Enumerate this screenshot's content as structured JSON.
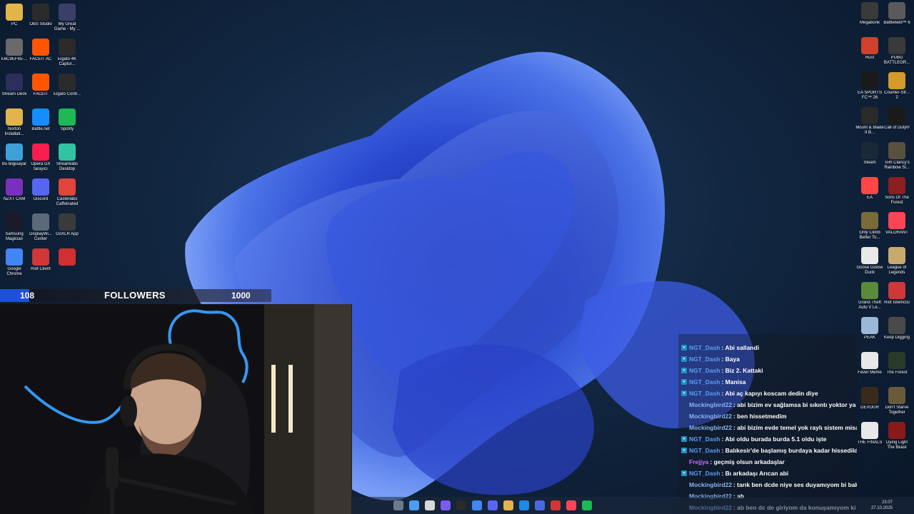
{
  "desktop_icons_left": [
    {
      "label": "PC",
      "icon": "folder-icon",
      "color": "#e2b54a"
    },
    {
      "label": "OBS Studio",
      "icon": "obs-icon",
      "color": "#2b2b2b"
    },
    {
      "label": "My Great Game - My ...",
      "icon": "game-icon",
      "color": "#3a3f6a"
    },
    {
      "label": "E6C9EF65-...",
      "icon": "file-icon",
      "color": "#6a6a6a"
    },
    {
      "label": "FACEIT AC",
      "icon": "faceit-icon",
      "color": "#ff5500"
    },
    {
      "label": "Elgato 4K Captur...",
      "icon": "elgato-4k-icon",
      "color": "#2b2b2b"
    },
    {
      "label": "Stream Deck",
      "icon": "stream-deck-icon",
      "color": "#2b2f5a"
    },
    {
      "label": "FACEIT",
      "icon": "faceit-icon",
      "color": "#ff5500"
    },
    {
      "label": "Elgato Contr...",
      "icon": "elgato-control-icon",
      "color": "#2b2b2b"
    },
    {
      "label": "Norton Installati...",
      "icon": "folder-icon",
      "color": "#e2b54a"
    },
    {
      "label": "Battle.net",
      "icon": "battlenet-icon",
      "color": "#148eff"
    },
    {
      "label": "Spotify",
      "icon": "spotify-icon",
      "color": "#1db954"
    },
    {
      "label": "Bu bilgisayar",
      "icon": "monitor-icon",
      "color": "#3ea0d8"
    },
    {
      "label": "Opera GX tarayıcı",
      "icon": "opera-gx-icon",
      "color": "#fa1e4e"
    },
    {
      "label": "Streamlabs Desktop",
      "icon": "streamlabs-icon",
      "color": "#31c3a2"
    },
    {
      "label": "NZXT CAM",
      "icon": "nzxt-icon",
      "color": "#7b2fbe"
    },
    {
      "label": "Discord",
      "icon": "discord-icon",
      "color": "#5865f2"
    },
    {
      "label": "Casterlabs Caffeinated",
      "icon": "casterlabs-icon",
      "color": "#e0443a"
    },
    {
      "label": "Samsung Magician",
      "icon": "samsung-magician-icon",
      "color": "#1a1a2a"
    },
    {
      "label": "DisplayWi... Center",
      "icon": "display-center-icon",
      "color": "#5a6a7a"
    },
    {
      "label": "GoXLR App",
      "icon": "goxlr-icon",
      "color": "#3a3a3a"
    },
    {
      "label": "Google Chrome",
      "icon": "chrome-icon",
      "color": "#4285f4"
    },
    {
      "label": "Riot Client",
      "icon": "riot-client-icon",
      "color": "#d13639"
    },
    {
      "label": "",
      "icon": "app-icon",
      "color": "#d03030"
    }
  ],
  "desktop_icons_right": [
    {
      "label": "Megabonk",
      "icon": "megabonk-icon",
      "color": "#3a3a3a"
    },
    {
      "label": "Battlefield™ 6",
      "icon": "battlefield-icon",
      "color": "#5a5a5a"
    },
    {
      "label": "Rust",
      "icon": "rust-icon",
      "color": "#ce412b"
    },
    {
      "label": "PUBG BATTLEGR...",
      "icon": "pubg-icon",
      "color": "#3a3a3a"
    },
    {
      "label": "EA SPORTS FC™ 26",
      "icon": "ea-fc-icon",
      "color": "#1a1a1a"
    },
    {
      "label": "Counter-Str... 2",
      "icon": "counter-strike-icon",
      "color": "#d49a2a"
    },
    {
      "label": "Mount & Blade II B...",
      "icon": "mount-blade-icon",
      "color": "#2a2a2a"
    },
    {
      "label": "Call of Duty®",
      "icon": "call-of-duty-icon",
      "color": "#1a1a1a"
    },
    {
      "label": "Steam",
      "icon": "steam-icon",
      "color": "#1b2838"
    },
    {
      "label": "Tom Clancy's Rainbow Si...",
      "icon": "rainbow-six-icon",
      "color": "#5a5040"
    },
    {
      "label": "EA",
      "icon": "ea-icon",
      "color": "#ff4747"
    },
    {
      "label": "Sons Of The Forest",
      "icon": "sons-forest-icon",
      "color": "#8a2020"
    },
    {
      "label": "Only Climb Better To...",
      "icon": "only-climb-icon",
      "color": "#7a6a3a"
    },
    {
      "label": "VALORANT",
      "icon": "valorant-icon",
      "color": "#fd4556"
    },
    {
      "label": "Goose Goose Duck",
      "icon": "goose-duck-icon",
      "color": "#e8e8e8"
    },
    {
      "label": "League of Legends",
      "icon": "league-icon",
      "color": "#c8aa6e"
    },
    {
      "label": "Grand Theft Auto V Le...",
      "icon": "gta-icon",
      "color": "#5a8a3a"
    },
    {
      "label": "Riot İstemcisi",
      "icon": "riot-client-icon",
      "color": "#d13639"
    },
    {
      "label": "PEAK",
      "icon": "peak-icon",
      "color": "#9ab8d8"
    },
    {
      "label": "Keep Digging",
      "icon": "keep-digging-icon",
      "color": "#4a4a4a"
    },
    {
      "label": "Fever Meme",
      "icon": "fever-meme-icon",
      "color": "#e8e8e8"
    },
    {
      "label": "The Forest",
      "icon": "the-forest-icon",
      "color": "#2a3a2a"
    },
    {
      "label": "DEVOUR",
      "icon": "devour-icon",
      "color": "#3a2a1a"
    },
    {
      "label": "Don't Starve Together",
      "icon": "dont-starve-icon",
      "color": "#6a5a3a"
    },
    {
      "label": "THE FINALS",
      "icon": "the-finals-icon",
      "color": "#e8e8e8"
    },
    {
      "label": "Dying Light The Beast",
      "icon": "dying-light-icon",
      "color": "#8a1a1a"
    }
  ],
  "followers": {
    "current": "108",
    "label": "FOLLOWERS",
    "goal": "1000",
    "progress": 0.108,
    "fill_color": "#1e50d8"
  },
  "chat": {
    "messages": [
      {
        "nick": "NGT_Dash",
        "msg": ": Abi sallandi",
        "badge": true,
        "color": "#5b9ff0"
      },
      {
        "nick": "NGT_Dash",
        "msg": ": Baya",
        "badge": true,
        "color": "#5b9ff0"
      },
      {
        "nick": "NGT_Dash",
        "msg": ": Biz 2. Kattaki",
        "badge": true,
        "color": "#5b9ff0"
      },
      {
        "nick": "NGT_Dash",
        "msg": ": Manisa",
        "badge": true,
        "color": "#5b9ff0"
      },
      {
        "nick": "NGT_Dash",
        "msg": ": Abi aç kapıyı koscam dedin diye",
        "badge": true,
        "color": "#5b9ff0"
      },
      {
        "nick": "Mockingbird22",
        "msg": ": abi bizim ev sağlamsa bi sıkıntı yoktor ya",
        "badge": false,
        "color": "#8ab4f0"
      },
      {
        "nick": "Mockingbird22",
        "msg": ": ben hissetmedim",
        "badge": false,
        "color": "#8ab4f0"
      },
      {
        "nick": "Mockingbird22",
        "msg": ": abi bizim evde temel yok raylı sistem misali",
        "badge": false,
        "color": "#8ab4f0"
      },
      {
        "nick": "NGT_Dash",
        "msg": ": Abi oldu burada burda 5.1 oldu işte",
        "badge": true,
        "color": "#5b9ff0"
      },
      {
        "nick": "NGT_Dash",
        "msg": ": Balıkesir'de başlamış burdaya kadar hissedildi",
        "badge": true,
        "color": "#5b9ff0"
      },
      {
        "nick": "Frejjya",
        "msg": ": geçmiş olsun arkadaşlar",
        "badge": false,
        "color": "#c070ff"
      },
      {
        "nick": "NGT_Dash",
        "msg": ": Bı arkadaşı Arıcan abi",
        "badge": true,
        "color": "#5b9ff0"
      },
      {
        "nick": "Mockingbird22",
        "msg": ": tarık ben dcde niye ses duyamıyom bi baksana",
        "badge": false,
        "color": "#8ab4f0"
      },
      {
        "nick": "Mockingbird22",
        "msg": ": ab",
        "badge": false,
        "color": "#8ab4f0"
      },
      {
        "nick": "Mockingbird22",
        "msg": ": ab ben dc de giriyom da konuşamıyom ki",
        "badge": false,
        "color": "#8ab4f0"
      }
    ]
  },
  "taskbar": {
    "icons": [
      "widgets-icon",
      "start-icon",
      "search-icon",
      "copilot-icon",
      "terminal-icon",
      "chrome-icon",
      "discord-icon",
      "folder-icon",
      "edge-icon",
      "store-icon",
      "riot-client-icon",
      "valorant-icon",
      "spotify-icon"
    ],
    "clock_time": "23:07",
    "clock_date": "27.10.2025"
  }
}
